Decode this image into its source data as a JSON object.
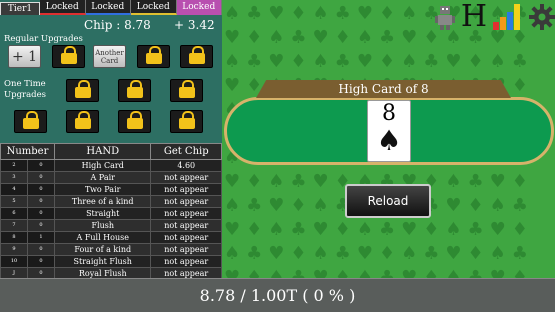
{
  "tabs": {
    "tier": "Tier1",
    "locked": [
      "Locked",
      "Locked",
      "Locked",
      "Locked"
    ]
  },
  "chip": {
    "label": "Chip : 8.78",
    "delta": "+ 3.42"
  },
  "upgrades": {
    "regular_label": "Regular Upgrades",
    "plus_one": "+ 1",
    "another_card": "Another Card",
    "one_time_label_1": "One Time",
    "one_time_label_2": "Upgrades"
  },
  "hand_table": {
    "headers": [
      "Number",
      "HAND",
      "Get Chip"
    ],
    "rows": [
      {
        "num": "2",
        "sub": "0",
        "hand": "High Card",
        "chip": "4.60"
      },
      {
        "num": "3",
        "sub": "0",
        "hand": "A Pair",
        "chip": "not appear"
      },
      {
        "num": "4",
        "sub": "0",
        "hand": "Two Pair",
        "chip": "not appear"
      },
      {
        "num": "5",
        "sub": "0",
        "hand": "Three of a kind",
        "chip": "not appear"
      },
      {
        "num": "6",
        "sub": "0",
        "hand": "Straight",
        "chip": "not appear"
      },
      {
        "num": "7",
        "sub": "0",
        "hand": "Flush",
        "chip": "not appear"
      },
      {
        "num": "8",
        "sub": "1",
        "hand": "A Full House",
        "chip": "not appear"
      },
      {
        "num": "9",
        "sub": "0",
        "hand": "Four of a kind",
        "chip": "not appear"
      },
      {
        "num": "10",
        "sub": "0",
        "hand": "Straight Flush",
        "chip": "not appear"
      },
      {
        "num": "J",
        "sub": "0",
        "hand": "Royal Flush",
        "chip": "not appear"
      }
    ]
  },
  "game": {
    "result_title": "High Card of 8",
    "card_rank": "8",
    "card_suit": "♠",
    "reload_label": "Reload"
  },
  "icons": {
    "robot": "robot-icon",
    "hand_rank": "H",
    "chart": "bar-chart-icon",
    "settings": "gear-icon"
  },
  "progress": {
    "text": "8.78 / 1.00T ( 0 % )"
  },
  "colors": {
    "panel_left": "#2d6f63",
    "felt": "#3fa641",
    "table_green": "#0d9a4f",
    "gold_border": "#d6b36a",
    "lock_yellow": "#f2c21a",
    "tab_purple": "#b84fb0"
  }
}
